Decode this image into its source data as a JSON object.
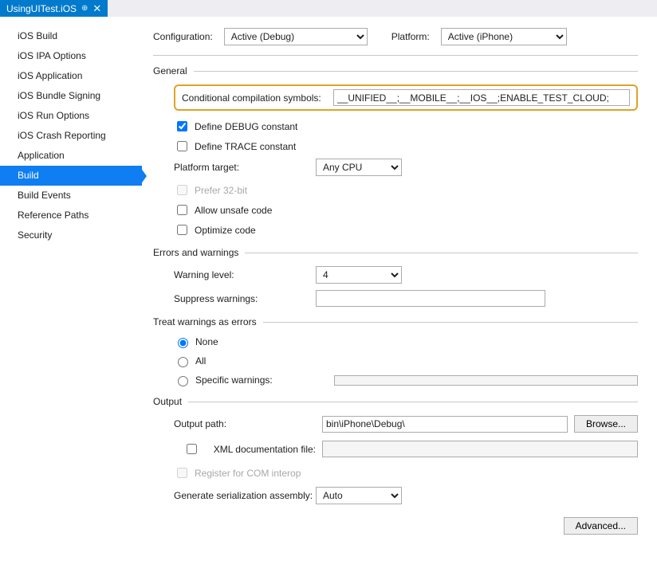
{
  "tab": {
    "title": "UsingUITest.iOS",
    "pin_glyph": "⊕",
    "close_glyph": "✕"
  },
  "sidebar": {
    "items": [
      "iOS Build",
      "iOS IPA Options",
      "iOS Application",
      "iOS Bundle Signing",
      "iOS Run Options",
      "iOS Crash Reporting",
      "Application",
      "Build",
      "Build Events",
      "Reference Paths",
      "Security"
    ],
    "selected_index": 7
  },
  "toprow": {
    "config_label": "Configuration:",
    "config_value": "Active (Debug)",
    "platform_label": "Platform:",
    "platform_value": "Active (iPhone)"
  },
  "general": {
    "title": "General",
    "cond_label": "Conditional compilation symbols:",
    "cond_value": "__UNIFIED__;__MOBILE__;__IOS__;ENABLE_TEST_CLOUD;",
    "define_debug": "Define DEBUG constant",
    "define_trace": "Define TRACE constant",
    "platform_target_label": "Platform target:",
    "platform_target_value": "Any CPU",
    "prefer_32": "Prefer 32-bit",
    "allow_unsafe": "Allow unsafe code",
    "optimize": "Optimize code"
  },
  "errors": {
    "title": "Errors and warnings",
    "warning_level_label": "Warning level:",
    "warning_level_value": "4",
    "suppress_label": "Suppress warnings:",
    "suppress_value": ""
  },
  "treat": {
    "title": "Treat warnings as errors",
    "none": "None",
    "all": "All",
    "specific": "Specific warnings:",
    "specific_value": ""
  },
  "output": {
    "title": "Output",
    "path_label": "Output path:",
    "path_value": "bin\\iPhone\\Debug\\",
    "browse": "Browse...",
    "xml_doc": "XML documentation file:",
    "xml_doc_value": "",
    "register_com": "Register for COM interop",
    "gen_ser_label": "Generate serialization assembly:",
    "gen_ser_value": "Auto"
  },
  "advanced": "Advanced..."
}
